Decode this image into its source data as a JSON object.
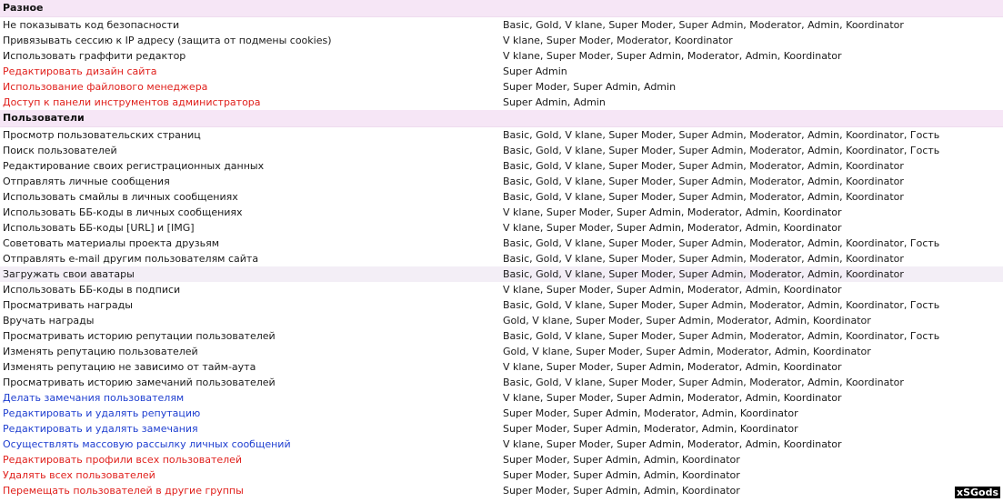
{
  "sections": [
    {
      "title": "Разное",
      "rows": [
        {
          "perm": "Не показывать код безопасности",
          "groups": "Basic, Gold, V klane, Super Moder, Super Admin, Moderator, Admin, Koordinator",
          "color": "normal"
        },
        {
          "perm": "Привязывать сессию к IP адресу (защита от подмены cookies)",
          "groups": "V klane, Super Moder, Moderator, Koordinator",
          "color": "normal"
        },
        {
          "perm": "Использовать граффити редактор",
          "groups": "V klane, Super Moder, Super Admin, Moderator, Admin, Koordinator",
          "color": "normal"
        },
        {
          "perm": "Редактировать дизайн сайта",
          "groups": "Super Admin",
          "color": "red"
        },
        {
          "perm": "Использование файлового менеджера",
          "groups": "Super Moder, Super Admin, Admin",
          "color": "red"
        },
        {
          "perm": "Доступ к панели инструментов администратора",
          "groups": "Super Admin, Admin",
          "color": "red"
        }
      ]
    },
    {
      "title": "Пользователи",
      "rows": [
        {
          "perm": "Просмотр пользовательских страниц",
          "groups": "Basic, Gold, V klane, Super Moder, Super Admin, Moderator, Admin, Koordinator, Гость",
          "color": "normal"
        },
        {
          "perm": "Поиск пользователей",
          "groups": "Basic, Gold, V klane, Super Moder, Super Admin, Moderator, Admin, Koordinator, Гость",
          "color": "normal"
        },
        {
          "perm": "Редактирование своих регистрационных данных",
          "groups": "Basic, Gold, V klane, Super Moder, Super Admin, Moderator, Admin, Koordinator",
          "color": "normal"
        },
        {
          "perm": "Отправлять личные сообщения",
          "groups": "Basic, Gold, V klane, Super Moder, Super Admin, Moderator, Admin, Koordinator",
          "color": "normal"
        },
        {
          "perm": "Использовать смайлы в личных сообщениях",
          "groups": "Basic, Gold, V klane, Super Moder, Super Admin, Moderator, Admin, Koordinator",
          "color": "normal"
        },
        {
          "perm": "Использовать ББ-коды в личных сообщениях",
          "groups": "V klane, Super Moder, Super Admin, Moderator, Admin, Koordinator",
          "color": "normal"
        },
        {
          "perm": "Использовать ББ-коды [URL] и [IMG]",
          "groups": "V klane, Super Moder, Super Admin, Moderator, Admin, Koordinator",
          "color": "normal"
        },
        {
          "perm": "Советовать материалы проекта друзьям",
          "groups": "Basic, Gold, V klane, Super Moder, Super Admin, Moderator, Admin, Koordinator, Гость",
          "color": "normal"
        },
        {
          "perm": "Отправлять e-mail другим пользователям сайта",
          "groups": "Basic, Gold, V klane, Super Moder, Super Admin, Moderator, Admin, Koordinator",
          "color": "normal"
        },
        {
          "perm": "Загружать свои аватары",
          "groups": "Basic, Gold, V klane, Super Moder, Super Admin, Moderator, Admin, Koordinator",
          "color": "normal",
          "highlight": true
        },
        {
          "perm": "Использовать ББ-коды в подписи",
          "groups": "V klane, Super Moder, Super Admin, Moderator, Admin, Koordinator",
          "color": "normal"
        },
        {
          "perm": "Просматривать награды",
          "groups": "Basic, Gold, V klane, Super Moder, Super Admin, Moderator, Admin, Koordinator, Гость",
          "color": "normal"
        },
        {
          "perm": "Вручать награды",
          "groups": "Gold, V klane, Super Moder, Super Admin, Moderator, Admin, Koordinator",
          "color": "normal"
        },
        {
          "perm": "Просматривать историю репутации пользователей",
          "groups": "Basic, Gold, V klane, Super Moder, Super Admin, Moderator, Admin, Koordinator, Гость",
          "color": "normal"
        },
        {
          "perm": "Изменять репутацию пользователей",
          "groups": "Gold, V klane, Super Moder, Super Admin, Moderator, Admin, Koordinator",
          "color": "normal"
        },
        {
          "perm": "Изменять репутацию не зависимо от тайм-аута",
          "groups": "V klane, Super Moder, Super Admin, Moderator, Admin, Koordinator",
          "color": "normal"
        },
        {
          "perm": "Просматривать историю замечаний пользователей",
          "groups": "Basic, Gold, V klane, Super Moder, Super Admin, Moderator, Admin, Koordinator",
          "color": "normal"
        },
        {
          "perm": "Делать замечания пользователям",
          "groups": "V klane, Super Moder, Super Admin, Moderator, Admin, Koordinator",
          "color": "blue"
        },
        {
          "perm": "Редактировать и удалять репутацию",
          "groups": "Super Moder, Super Admin, Moderator, Admin, Koordinator",
          "color": "blue"
        },
        {
          "perm": "Редактировать и удалять замечания",
          "groups": "Super Moder, Super Admin, Moderator, Admin, Koordinator",
          "color": "blue"
        },
        {
          "perm": "Осуществлять массовую рассылку личных сообщений",
          "groups": "V klane, Super Moder, Super Admin, Moderator, Admin, Koordinator",
          "color": "blue"
        },
        {
          "perm": "Редактировать профили всех пользователей",
          "groups": "Super Moder, Super Admin, Admin, Koordinator",
          "color": "red"
        },
        {
          "perm": "Удалять всех пользователей",
          "groups": "Super Moder, Super Admin, Admin, Koordinator",
          "color": "red"
        },
        {
          "perm": "Перемещать пользователей в другие группы",
          "groups": "Super Moder, Super Admin, Admin, Koordinator",
          "color": "red"
        }
      ]
    }
  ],
  "watermark": "xSGods"
}
